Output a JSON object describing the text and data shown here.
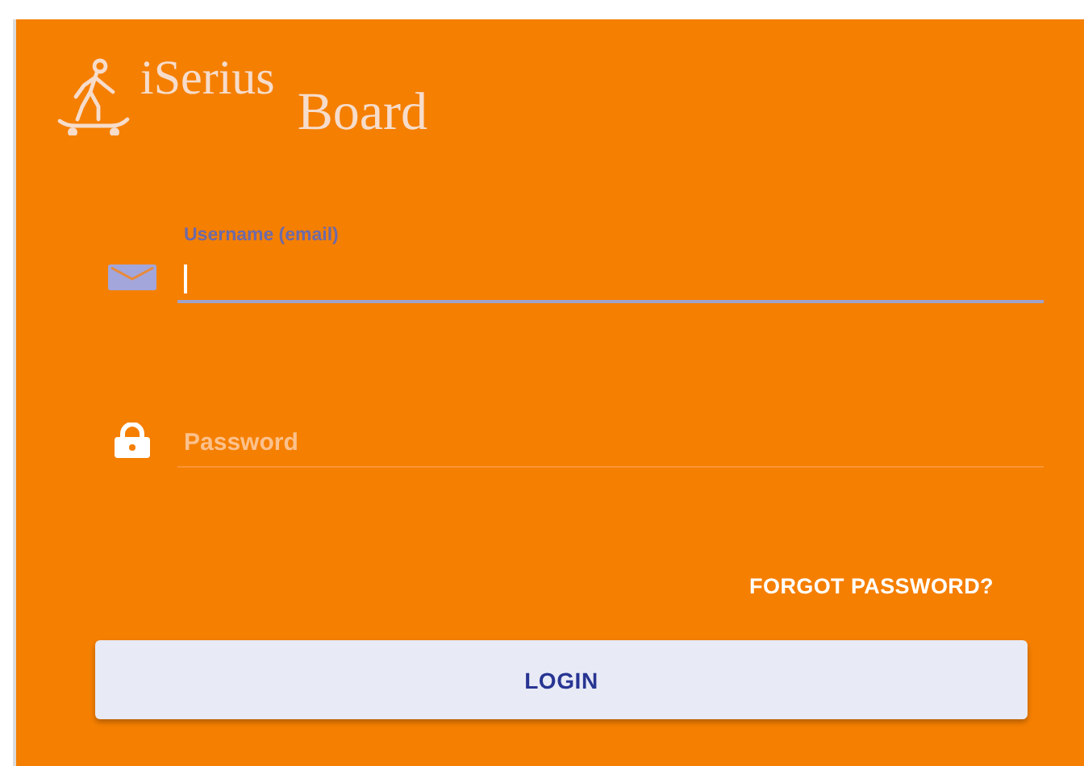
{
  "logo": {
    "line_1": "iSerius",
    "line_2": "Board"
  },
  "fields": [
    {
      "kind": "email",
      "label": "Username (email)",
      "focused": true
    },
    {
      "kind": "password",
      "placeholder": "Password",
      "focused": false
    }
  ],
  "forgot_link": "FORGOT PASSWORD?",
  "login_button": "LOGIN"
}
